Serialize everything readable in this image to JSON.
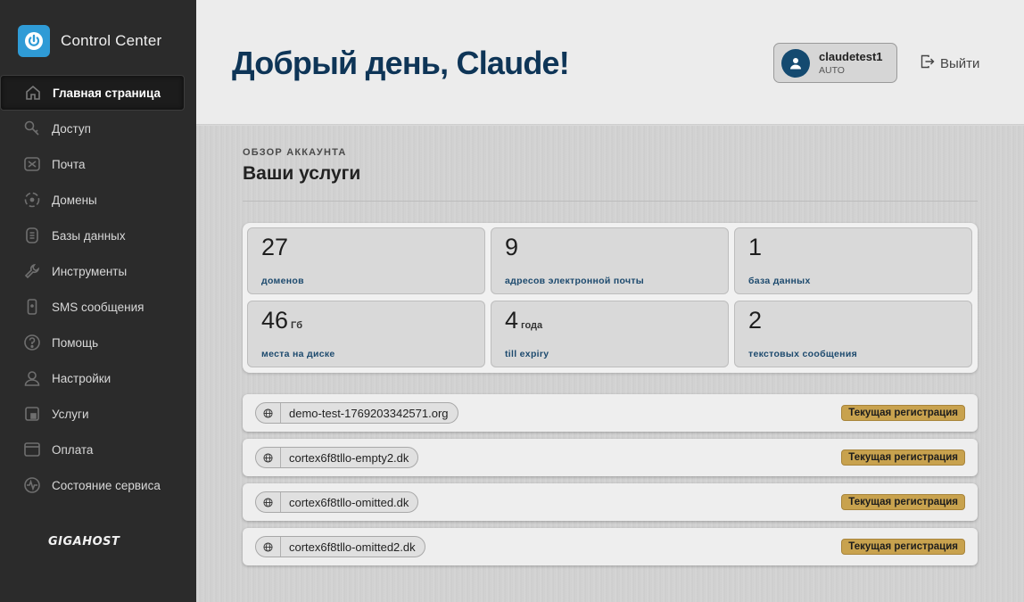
{
  "app": {
    "title": "Control Center",
    "footer_logo": "GIGAHOST"
  },
  "sidebar": {
    "items": [
      {
        "label": "Главная страница",
        "icon": "home-icon",
        "active": true
      },
      {
        "label": "Доступ",
        "icon": "key-icon"
      },
      {
        "label": "Почта",
        "icon": "mail-icon"
      },
      {
        "label": "Домены",
        "icon": "globe-icon"
      },
      {
        "label": "Базы данных",
        "icon": "database-icon"
      },
      {
        "label": "Инструменты",
        "icon": "wrench-icon"
      },
      {
        "label": "SMS сообщения",
        "icon": "phone-icon"
      },
      {
        "label": "Помощь",
        "icon": "help-icon"
      },
      {
        "label": "Настройки",
        "icon": "user-icon"
      },
      {
        "label": "Услуги",
        "icon": "services-icon"
      },
      {
        "label": "Оплата",
        "icon": "card-icon"
      },
      {
        "label": "Состояние сервиса",
        "icon": "pulse-icon"
      }
    ]
  },
  "header": {
    "greeting": "Добрый день, Claude!",
    "user": {
      "name": "claudetest1",
      "role": "AUTO"
    },
    "logout_label": "Выйти"
  },
  "overview": {
    "eyebrow": "ОБЗОР АККАУНТА",
    "title": "Ваши услуги",
    "stats": [
      {
        "value": "27",
        "unit": "",
        "label": "доменов"
      },
      {
        "value": "9",
        "unit": "",
        "label": "адресов электронной почты"
      },
      {
        "value": "1",
        "unit": "",
        "label": "база данных"
      },
      {
        "value": "46",
        "unit": "Гб",
        "label": "места на диске"
      },
      {
        "value": "4",
        "unit": "года",
        "label": "till expiry"
      },
      {
        "value": "2",
        "unit": "",
        "label": "текстовых сообщения"
      }
    ]
  },
  "domains": [
    {
      "name": "demo-test-1769203342571.org",
      "status": "Текущая регистрация"
    },
    {
      "name": "cortex6f8tllo-empty2.dk",
      "status": "Текущая регистрация"
    },
    {
      "name": "cortex6f8tllo-omitted.dk",
      "status": "Текущая регистрация"
    },
    {
      "name": "cortex6f8tllo-omitted2.dk",
      "status": "Текущая регистрация"
    }
  ],
  "colors": {
    "accent": "#2f9bd6",
    "heading": "#0e3557",
    "badge": "#c8a24e",
    "sidebar": "#2b2b2b"
  }
}
